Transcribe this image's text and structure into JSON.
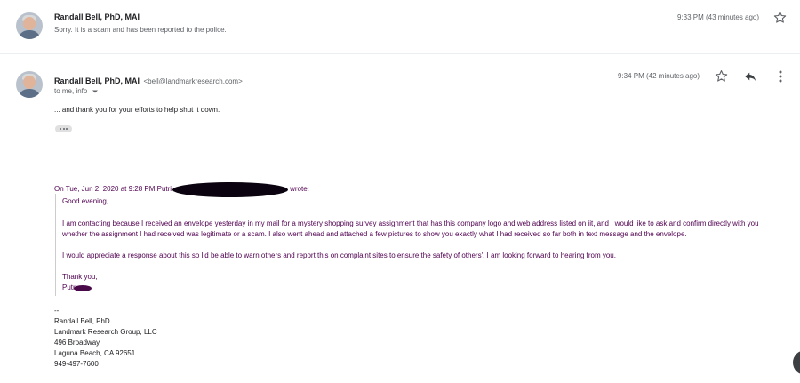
{
  "message1": {
    "sender": "Randall Bell, PhD, MAI",
    "snippet": "Sorry. It is a scam and has been reported to the police.",
    "time": "9:33 PM (43 minutes ago)"
  },
  "message2": {
    "sender": "Randall Bell, PhD, MAI",
    "email": "<bell@landmarkresearch.com>",
    "recipients": "to me, info",
    "time": "9:34 PM (42 minutes ago)",
    "body": "... and thank you for your efforts to help shut it down.",
    "quote_header_prefix": "On Tue, Jun 2, 2020 at 9:28 PM Putri",
    "quote_header_suffix": "wrote:",
    "quote": {
      "greeting": "Good evening,",
      "para1_line1": "I am contacting because I received an envelope yesterday in my mail for a mystery shopping survey assignment that has this company logo and web address listed on iit, and I would like to ask and confirm directly with you",
      "para1_line2": "whether the assignment I had received was legitimate or a scam. I also went ahead and attached a few pictures to show you exactly what I had received so far both in text message and the envelope.",
      "para2": "I would appreciate a response about this so I'd be able to warn others and report this on complaint sites to ensure the safety of others'. I am looking forward to hearing from you.",
      "closing": "Thank you,",
      "name": "Putri"
    },
    "signature": {
      "dashes": "--",
      "name": "Randall Bell, PhD",
      "company": "Landmark Research Group, LLC",
      "street": "496 Broadway",
      "city": "Laguna Beach, CA 92651",
      "phone": "949-497-7600"
    }
  },
  "icons": [
    "avatar",
    "star-icon",
    "reply-icon",
    "more-vert-icon",
    "dropdown-arrow-icon",
    "ellipsis-icon"
  ]
}
